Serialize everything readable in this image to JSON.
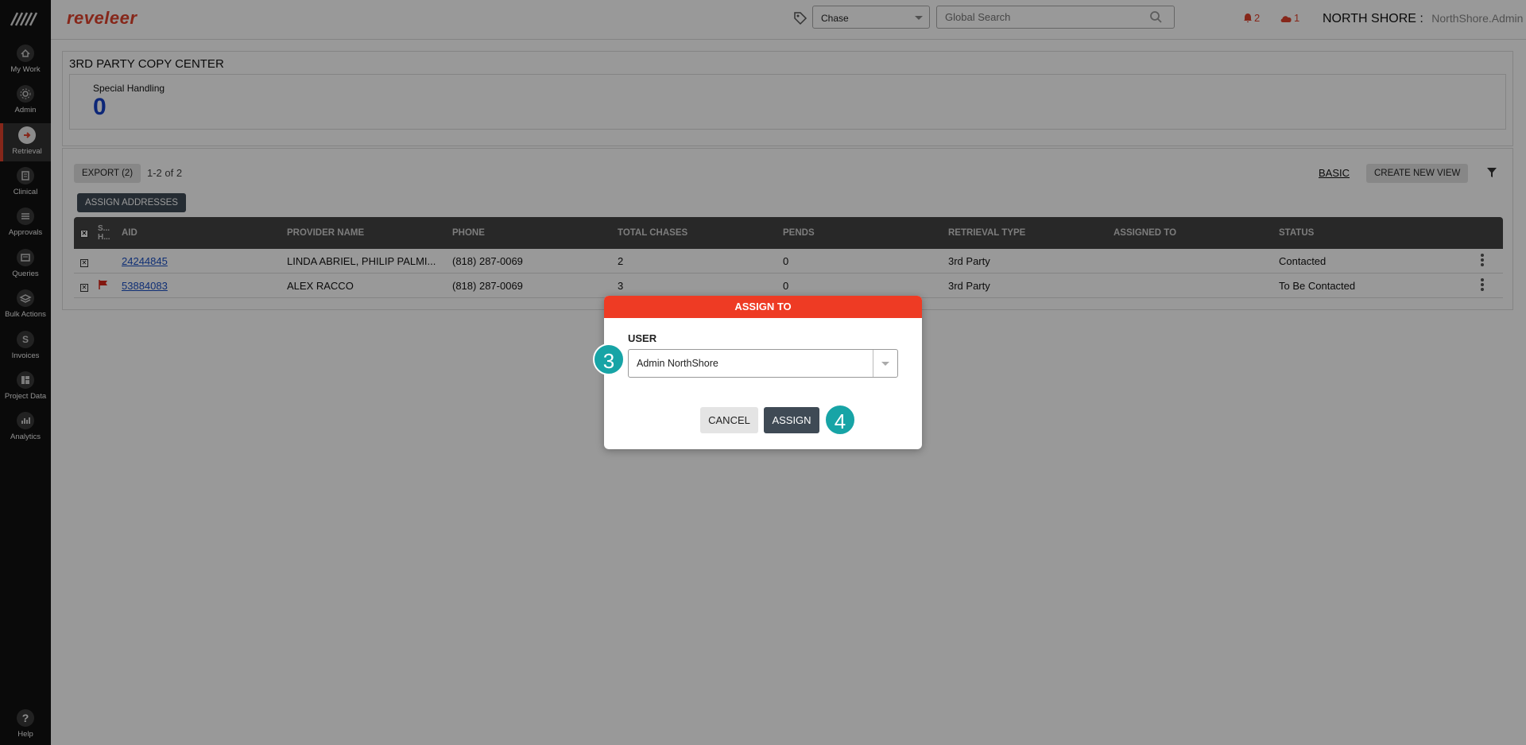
{
  "sidebar": {
    "items": [
      {
        "label": "My Work",
        "icon": "home-icon"
      },
      {
        "label": "Admin",
        "icon": "gear-icon"
      },
      {
        "label": "Retrieval",
        "icon": "arrow-right-icon"
      },
      {
        "label": "Clinical",
        "icon": "clipboard-icon"
      },
      {
        "label": "Approvals",
        "icon": "checklist-icon"
      },
      {
        "label": "Queries",
        "icon": "document-icon"
      },
      {
        "label": "Bulk Actions",
        "icon": "layers-icon"
      },
      {
        "label": "Invoices",
        "icon": "dollar-icon"
      },
      {
        "label": "Project Data",
        "icon": "grid-icon"
      },
      {
        "label": "Analytics",
        "icon": "bar-chart-icon"
      }
    ],
    "help_label": "Help",
    "help_glyph": "?"
  },
  "header": {
    "brand": "reveleer",
    "chase_select": "Chase",
    "search_placeholder": "Global Search",
    "alerts_count": "2",
    "cloud_count": "1",
    "org": "NORTH SHORE :",
    "user": "NorthShore.Admin"
  },
  "section": {
    "title": "3RD PARTY COPY CENTER",
    "special_handling_label": "Special Handling",
    "special_handling_value": "0"
  },
  "grid": {
    "export_label": "EXPORT (2)",
    "count_label": "1-2  of  2",
    "basic_label": "BASIC",
    "create_view_label": "CREATE NEW VIEW",
    "assign_addresses_label": "ASSIGN ADDRESSES",
    "columns": {
      "sh": "S... H...",
      "aid": "AID",
      "provider": "PROVIDER NAME",
      "phone": "PHONE",
      "total_chases": "TOTAL CHASES",
      "pends": "PENDS",
      "retrieval_type": "RETRIEVAL TYPE",
      "assigned_to": "ASSIGNED TO",
      "status": "STATUS"
    },
    "rows": [
      {
        "aid": "24244845",
        "provider": "LINDA ABRIEL, PHILIP PALMI...",
        "phone": "(818) 287-0069",
        "total_chases": "2",
        "pends": "0",
        "retrieval_type": "3rd Party",
        "assigned_to": "",
        "status": "Contacted",
        "flag": false
      },
      {
        "aid": "53884083",
        "provider": "ALEX RACCO",
        "phone": "(818) 287-0069",
        "total_chases": "3",
        "pends": "0",
        "retrieval_type": "3rd Party",
        "assigned_to": "",
        "status": "To Be Contacted",
        "flag": true
      }
    ]
  },
  "modal": {
    "title": "ASSIGN TO",
    "user_label": "USER",
    "user_value": "Admin NorthShore",
    "cancel_label": "CANCEL",
    "assign_label": "ASSIGN"
  },
  "steps": {
    "step_a": "3",
    "step_b": "4"
  },
  "colors": {
    "brand": "#e0412c",
    "modal_header": "#ee3b24",
    "step_badge": "#17a4a6",
    "primary_button": "#3f4a55",
    "link": "#1a4fc4"
  }
}
